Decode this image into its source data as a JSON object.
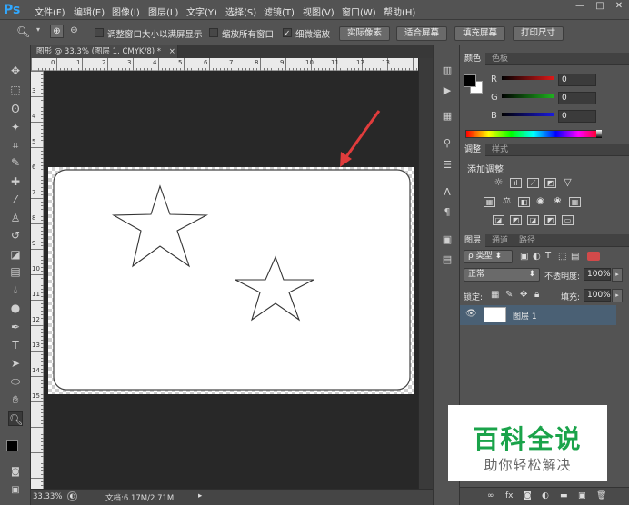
{
  "app": {
    "logo": "Ps"
  },
  "menu": {
    "items": [
      "文件(F)",
      "编辑(E)",
      "图像(I)",
      "图层(L)",
      "文字(Y)",
      "选择(S)",
      "滤镜(T)",
      "视图(V)",
      "窗口(W)",
      "帮助(H)"
    ],
    "window_controls": [
      "—",
      "□",
      "✕"
    ]
  },
  "options": {
    "resize_windows_label": "调整窗口大小以满屏显示",
    "zoom_all_label": "缩放所有窗口",
    "scrubby_zoom_label": "细微缩放",
    "scrubby_checked": "✓",
    "buttons": [
      "实际像素",
      "适合屏幕",
      "填充屏幕",
      "打印尺寸"
    ]
  },
  "document": {
    "tab_title": "图形 @ 33.3% (图层 1, CMYK/8) *",
    "tab_close": "×"
  },
  "ruler_top_marks": [
    "0",
    "1",
    "2",
    "3",
    "4",
    "5",
    "6",
    "7",
    "8",
    "9",
    "10",
    "11",
    "12",
    "13"
  ],
  "ruler_left_marks": [
    "3",
    "4",
    "5",
    "6",
    "7",
    "8",
    "9",
    "10",
    "11",
    "12",
    "13",
    "14",
    "15"
  ],
  "status": {
    "zoom": "33.33%",
    "doc_info": "文档:6.17M/2.71M"
  },
  "color_panel": {
    "tabs": [
      "颜色",
      "色板"
    ],
    "channels": [
      {
        "label": "R",
        "value": "0",
        "color": "#e01a1a"
      },
      {
        "label": "G",
        "value": "0",
        "color": "#1fb31f"
      },
      {
        "label": "B",
        "value": "0",
        "color": "#1a1ae0"
      }
    ]
  },
  "adjustments_panel": {
    "tabs": [
      "调整",
      "样式"
    ],
    "title": "添加调整"
  },
  "layers_panel": {
    "tabs": [
      "图层",
      "通道",
      "路径"
    ],
    "kind_label": "ρ 类型",
    "blend_mode": "正常",
    "opacity_label": "不透明度:",
    "opacity_value": "100%",
    "lock_label": "锁定:",
    "fill_label": "填充:",
    "fill_value": "100%",
    "layers": [
      {
        "name": "图层 1",
        "visible": true
      }
    ]
  },
  "watermark": {
    "title": "百科全说",
    "subtitle": "助你轻松解决",
    "title_color": "#1aa34a"
  },
  "colors": {
    "menu_bg": "#535353",
    "workspace_bg": "#282828",
    "arrow_red": "#e03c3c",
    "selected_layer": "#4a6074"
  }
}
